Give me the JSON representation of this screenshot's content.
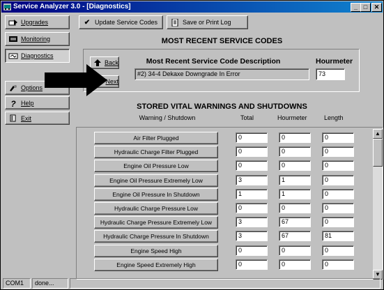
{
  "window": {
    "title": "Service Analyzer 3.0 - [Diagnostics]"
  },
  "sidebar": {
    "items": [
      {
        "label": "Upgrades",
        "icon": "upgrades-icon"
      },
      {
        "label": "Monitoring",
        "icon": "monitoring-icon"
      },
      {
        "label": "Diagnostics",
        "icon": "diagnostics-icon"
      },
      {
        "label": "Options",
        "icon": "options-icon"
      },
      {
        "label": "Help",
        "icon": "help-icon"
      },
      {
        "label": "Exit",
        "icon": "exit-icon"
      }
    ]
  },
  "toolbar": {
    "update_label": "Update Service Codes",
    "save_label": "Save or Print Log"
  },
  "service_codes": {
    "heading": "MOST RECENT SERVICE CODES",
    "description_header": "Most Recent Service Code Description",
    "hourmeter_header": "Hourmeter",
    "back_label": "Back",
    "next_label": "Next",
    "description_value": "#2)  34-4  Dekaxe Downgrade In Error",
    "hourmeter_value": "73"
  },
  "warnings": {
    "heading": "STORED VITAL WARNINGS AND SHUTDOWNS",
    "col_name": "Warning / Shutdown",
    "col_total": "Total",
    "col_hourmeter": "Hourmeter",
    "col_length": "Length",
    "rows": [
      {
        "name": "Air Filter Plugged",
        "total": "0",
        "hourmeter": "0",
        "length": "0"
      },
      {
        "name": "Hydraulic Charge Filter Plugged",
        "total": "0",
        "hourmeter": "0",
        "length": "0"
      },
      {
        "name": "Engine Oil Pressure Low",
        "total": "0",
        "hourmeter": "0",
        "length": "0"
      },
      {
        "name": "Engine Oil Pressure Extremely Low",
        "total": "3",
        "hourmeter": "1",
        "length": "0"
      },
      {
        "name": "Engine Oil Pressure In Shutdown",
        "total": "1",
        "hourmeter": "1",
        "length": "0"
      },
      {
        "name": "Hydraulic Charge Pressure Low",
        "total": "0",
        "hourmeter": "0",
        "length": "0"
      },
      {
        "name": "Hydraulic Charge Pressure Extremely Low",
        "total": "3",
        "hourmeter": "67",
        "length": "0"
      },
      {
        "name": "Hydraulic Charge Pressure In Shutdown",
        "total": "3",
        "hourmeter": "67",
        "length": "81"
      },
      {
        "name": "Engine Speed High",
        "total": "0",
        "hourmeter": "0",
        "length": "0"
      },
      {
        "name": "Engine Speed Extremely High",
        "total": "0",
        "hourmeter": "0",
        "length": "0"
      }
    ]
  },
  "status": {
    "port": "COM1",
    "state": "done..."
  }
}
